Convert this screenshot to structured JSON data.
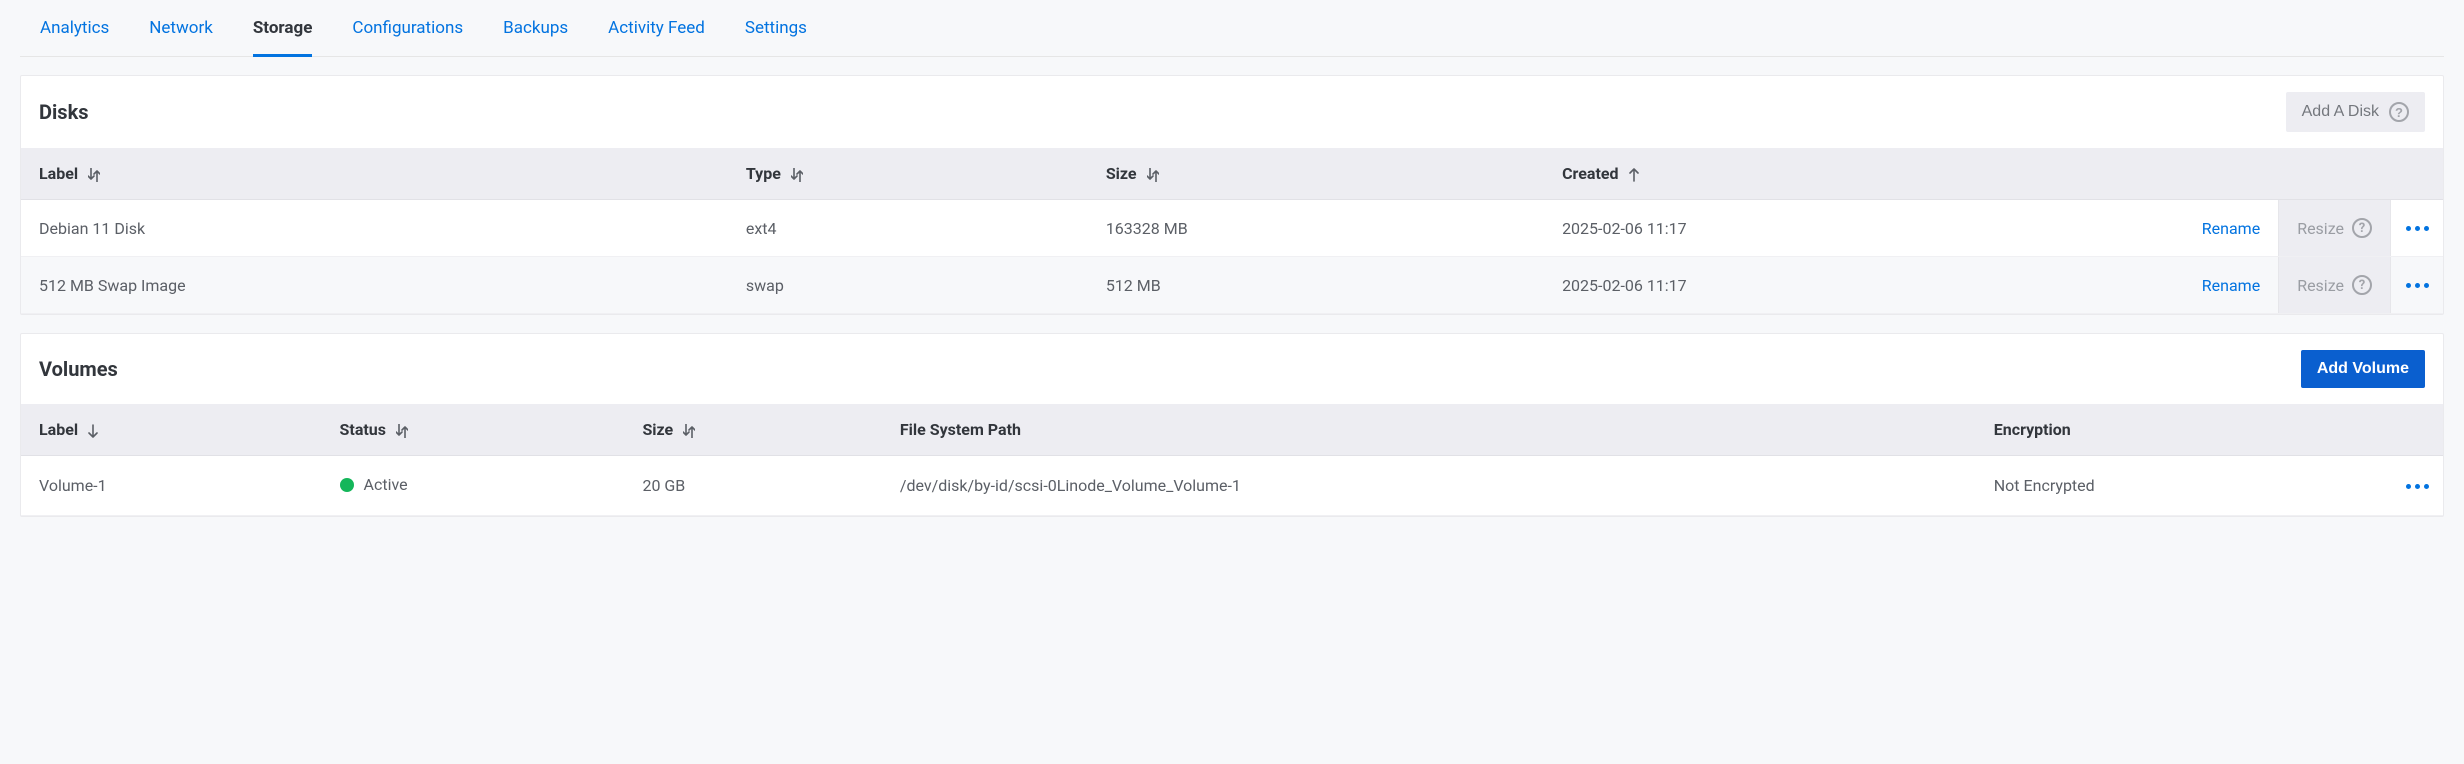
{
  "tabs": [
    {
      "label": "Analytics",
      "active": false
    },
    {
      "label": "Network",
      "active": false
    },
    {
      "label": "Storage",
      "active": true
    },
    {
      "label": "Configurations",
      "active": false
    },
    {
      "label": "Backups",
      "active": false
    },
    {
      "label": "Activity Feed",
      "active": false
    },
    {
      "label": "Settings",
      "active": false
    }
  ],
  "disks": {
    "title": "Disks",
    "add_button": "Add A Disk",
    "columns": {
      "label": "Label",
      "type": "Type",
      "size": "Size",
      "created": "Created"
    },
    "actions": {
      "rename": "Rename",
      "resize": "Resize"
    },
    "rows": [
      {
        "label": "Debian 11 Disk",
        "type": "ext4",
        "size": "163328 MB",
        "created": "2025-02-06 11:17"
      },
      {
        "label": "512 MB Swap Image",
        "type": "swap",
        "size": "512 MB",
        "created": "2025-02-06 11:17"
      }
    ]
  },
  "volumes": {
    "title": "Volumes",
    "add_button": "Add Volume",
    "columns": {
      "label": "Label",
      "status": "Status",
      "size": "Size",
      "path": "File System Path",
      "encryption": "Encryption"
    },
    "rows": [
      {
        "label": "Volume-1",
        "status": "Active",
        "size": "20 GB",
        "path": "/dev/disk/by-id/scsi-0Linode_Volume_Volume-1",
        "encryption": "Not Encrypted"
      }
    ]
  }
}
